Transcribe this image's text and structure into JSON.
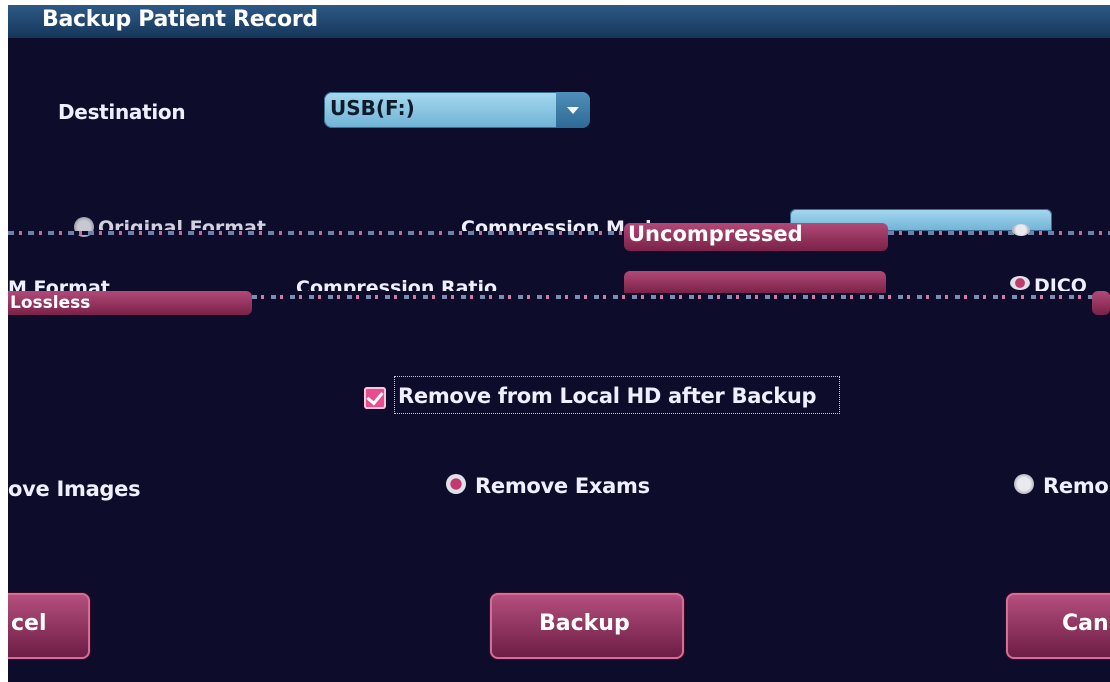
{
  "title": "Backup Patient Record",
  "destination": {
    "label": "Destination",
    "value": "USB(F:)"
  },
  "glitch_row_1": {
    "option_original": "Original Format",
    "compression_mode_label": "Compression Mode",
    "compression_value": "Uncompressed"
  },
  "glitch_row_2": {
    "dicom_format_fragment": "M Format",
    "compression_ratio_label": "Compression Ratio",
    "lossless_value": "Lossless",
    "dicom_fragment": "DICO"
  },
  "remove_local": {
    "label": "Remove from Local HD after Backup",
    "checked": true
  },
  "remove_options": {
    "remove_images": "ove Images",
    "remove_exams": "Remove Exams",
    "remove_more": "Remo",
    "selected": "Remove Exams"
  },
  "buttons": {
    "cancel_left": "cel",
    "backup": "Backup",
    "cancel_right": "Can"
  },
  "colors": {
    "background": "#0d0d2b",
    "titlebar": "#1f4872",
    "dropdown": "#8ec7e4",
    "accent_pink": "#b24978"
  }
}
